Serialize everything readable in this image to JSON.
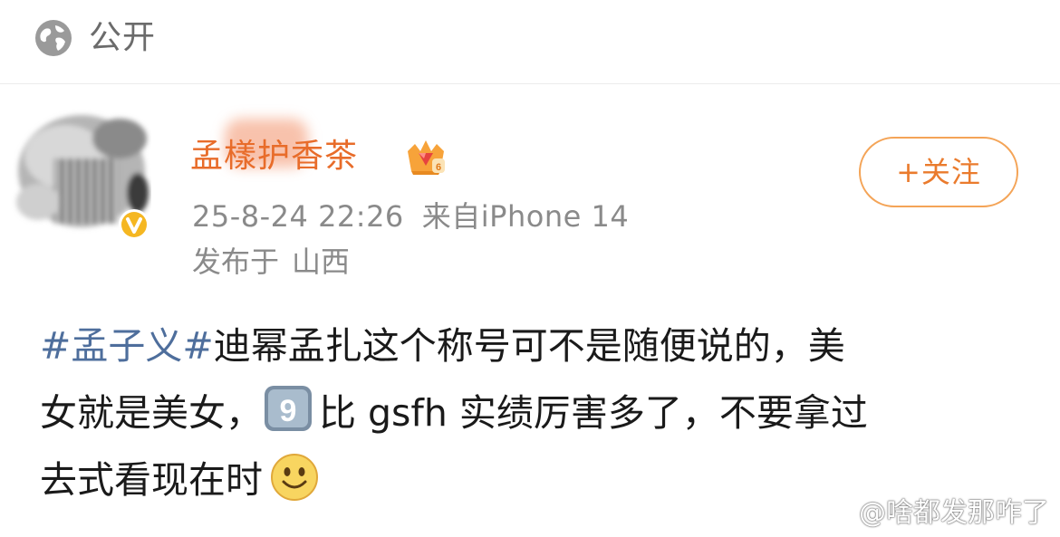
{
  "header": {
    "visibility_icon": "globe-icon",
    "visibility_label": "公开"
  },
  "post": {
    "username": "孟樣护香茶",
    "badge": "crown-icon",
    "verified_icon": "verified-v-icon",
    "follow_label": "+关注",
    "timestamp": "25-8-24 22:26",
    "source": "来自iPhone 14",
    "location_prefix": "发布于",
    "location": "山西",
    "content": {
      "hashtag": "#孟子义#",
      "line1_rest": "迪幂孟扎这个称号可不是随便说的，美",
      "line2_a": "女就是美女，",
      "keycap_emoji": "keycap-nine-emoji",
      "line2_b": "比 gsfh 实绩厉害多了，不要拿过",
      "line3": "去式看现在时",
      "smile_emoji": "smiling-face-emoji"
    }
  },
  "watermark": {
    "icon": "weibo-icon",
    "text": "@啥都发那咋了"
  },
  "colors": {
    "username": "#e86c2a",
    "follow": "#ea7b2d",
    "hashtag": "#4e6e9c",
    "meta": "#8a8a8a"
  }
}
